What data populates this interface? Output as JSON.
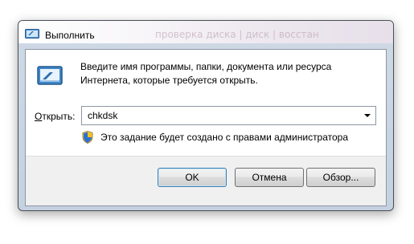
{
  "window": {
    "title": "Выполнить",
    "background_text": "проверка диска | диск | восстан"
  },
  "dialog": {
    "description": "Введите имя программы, папки, документа или ресурса Интернета, которые требуется открыть.",
    "open_label_mnemonic": "О",
    "open_label_rest": "ткрыть:",
    "open_value": "chkdsk",
    "admin_note": "Это задание будет создано с правами администратора"
  },
  "buttons": {
    "ok": "OK",
    "cancel": "Отмена",
    "browse": "Обзор..."
  },
  "icons": {
    "title": "run-icon",
    "main": "run-icon",
    "uac": "uac-shield-icon",
    "dropdown": "chevron-down-icon"
  },
  "colors": {
    "frame": "#c5d1e0",
    "default_button_border": "#3c7fb1",
    "footer": "#f0f0f0"
  }
}
